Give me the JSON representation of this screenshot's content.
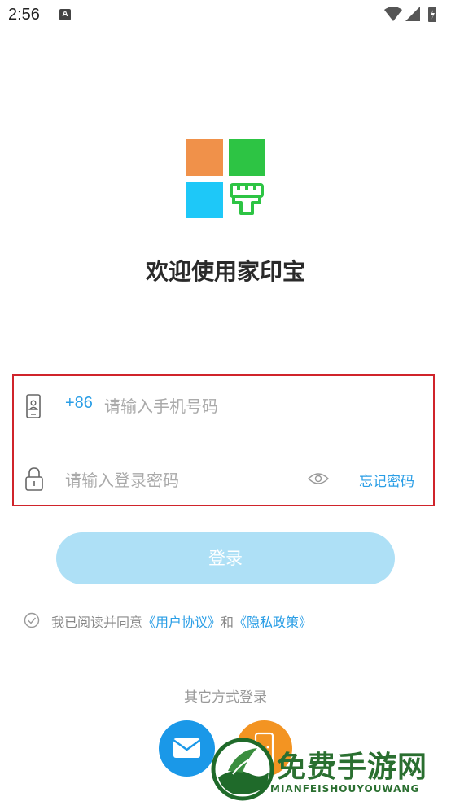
{
  "status_bar": {
    "time": "2:56",
    "notification_icon": "font-a-icon",
    "icons": [
      "wifi-icon",
      "signal-icon",
      "battery-icon"
    ]
  },
  "app": {
    "logo": "app-logo-grid-brush",
    "welcome": "欢迎使用家印宝",
    "brand_colors": {
      "orange": "#f0914a",
      "green": "#2dc444",
      "blue": "#1ec8f8",
      "accent": "#2a9ee6"
    }
  },
  "login_form": {
    "country_code": "+86",
    "phone_placeholder": "请输入手机号码",
    "password_placeholder": "请输入登录密码",
    "forgot_password": "忘记密码",
    "login_button": "登录"
  },
  "agreement": {
    "prefix": "我已阅读并同意",
    "user_agreement": "《用户协议》",
    "conjunction": "和",
    "privacy_policy": "《隐私政策》"
  },
  "other_login": {
    "label": "其它方式登录",
    "methods": [
      "mail-icon",
      "mobile-phone-icon"
    ]
  },
  "watermark": {
    "title": "免费手游网",
    "subtitle": "MIANFEISHOUYOUWANG"
  }
}
